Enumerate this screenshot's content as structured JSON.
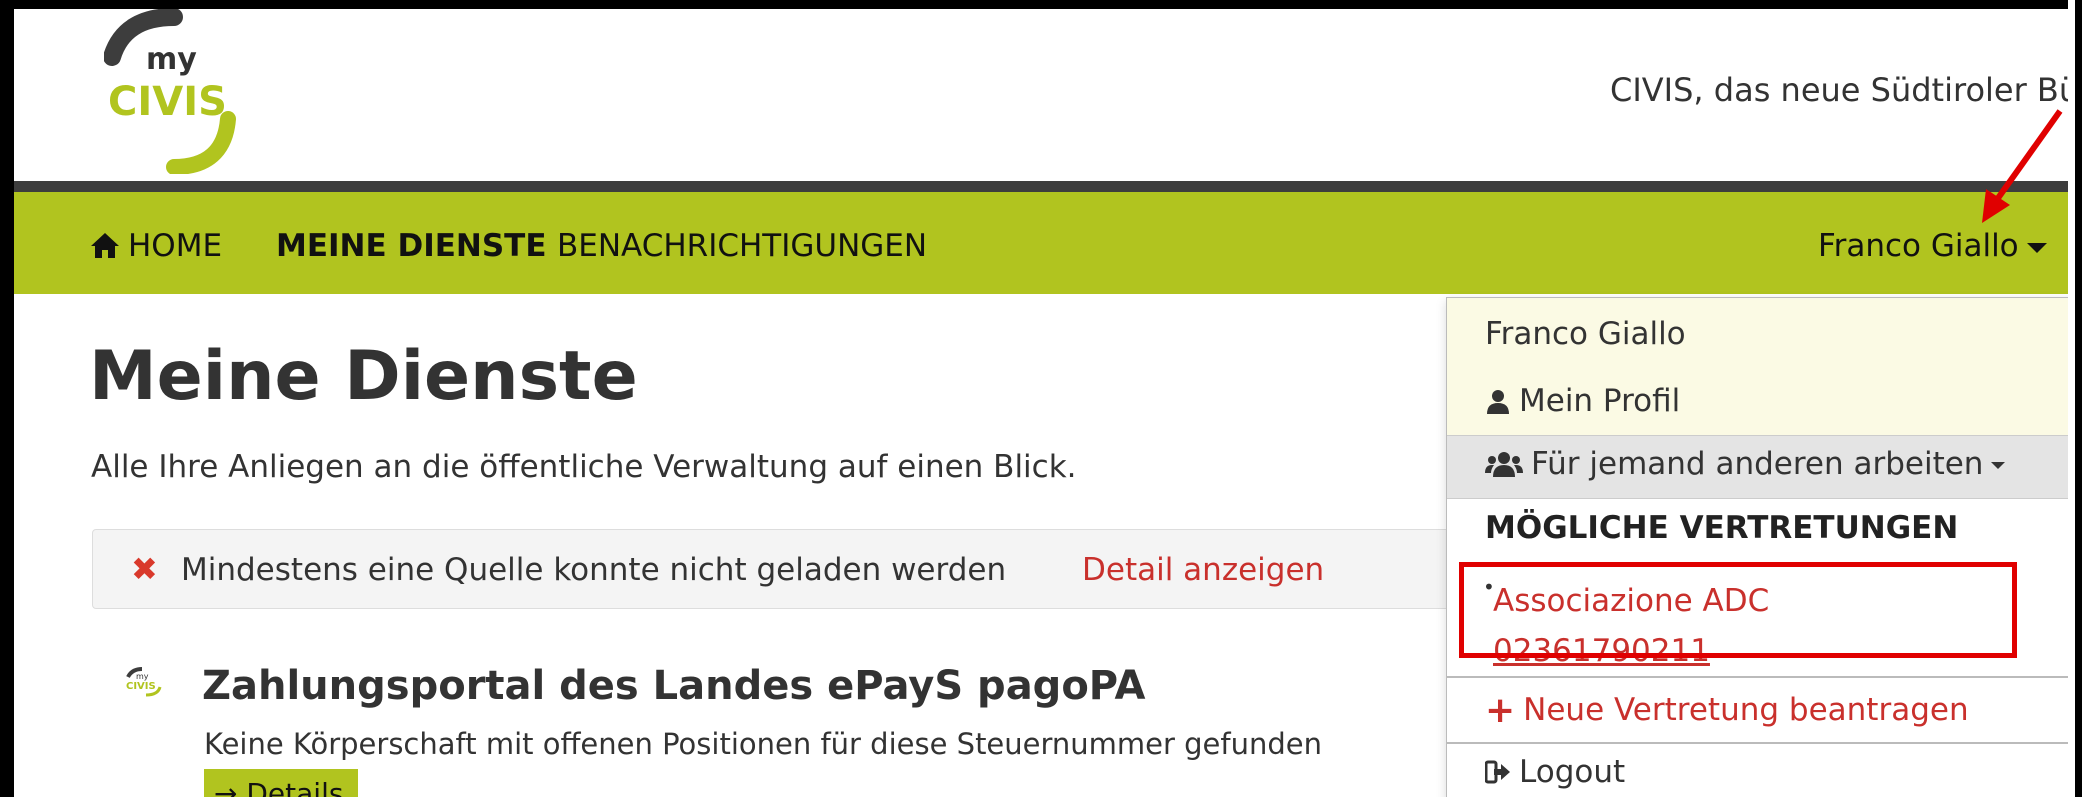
{
  "header": {
    "logo_small": "my",
    "logo_main": "CIVIS",
    "tagline": "CIVIS, das neue Südtiroler Bürg"
  },
  "nav": {
    "home": "HOME",
    "meine_dienste": "MEINE DIENSTE",
    "benachrichtigungen": "BENACHRICHTIGUNGEN",
    "user": "Franco Giallo"
  },
  "main": {
    "title": "Meine Dienste",
    "subtitle": "Alle Ihre Anliegen an die öffentliche Verwaltung auf einen Blick.",
    "alert": {
      "message": "Mindestens eine Quelle konnte nicht geladen werden",
      "link": "Detail anzeigen"
    },
    "service": {
      "title": "Zahlungsportal des Landes ePayS  pagoPA",
      "description": "Keine Körperschaft mit offenen Positionen für diese Steuernummer gefunden",
      "button": "Details"
    }
  },
  "dropdown": {
    "name": "Franco Giallo",
    "profile": "Mein Profil",
    "work_for_others": "Für jemand anderen arbeiten",
    "section_heading": "MÖGLICHE VERTRETUNGEN",
    "representation_name": "Associazione ADC",
    "representation_code": "02361790211",
    "new_representation": "Neue Vertretung beantragen",
    "logout": "Logout"
  },
  "colors": {
    "brand_green": "#b1c41f",
    "link_red": "#c9302c",
    "highlight_red": "#e00000"
  }
}
